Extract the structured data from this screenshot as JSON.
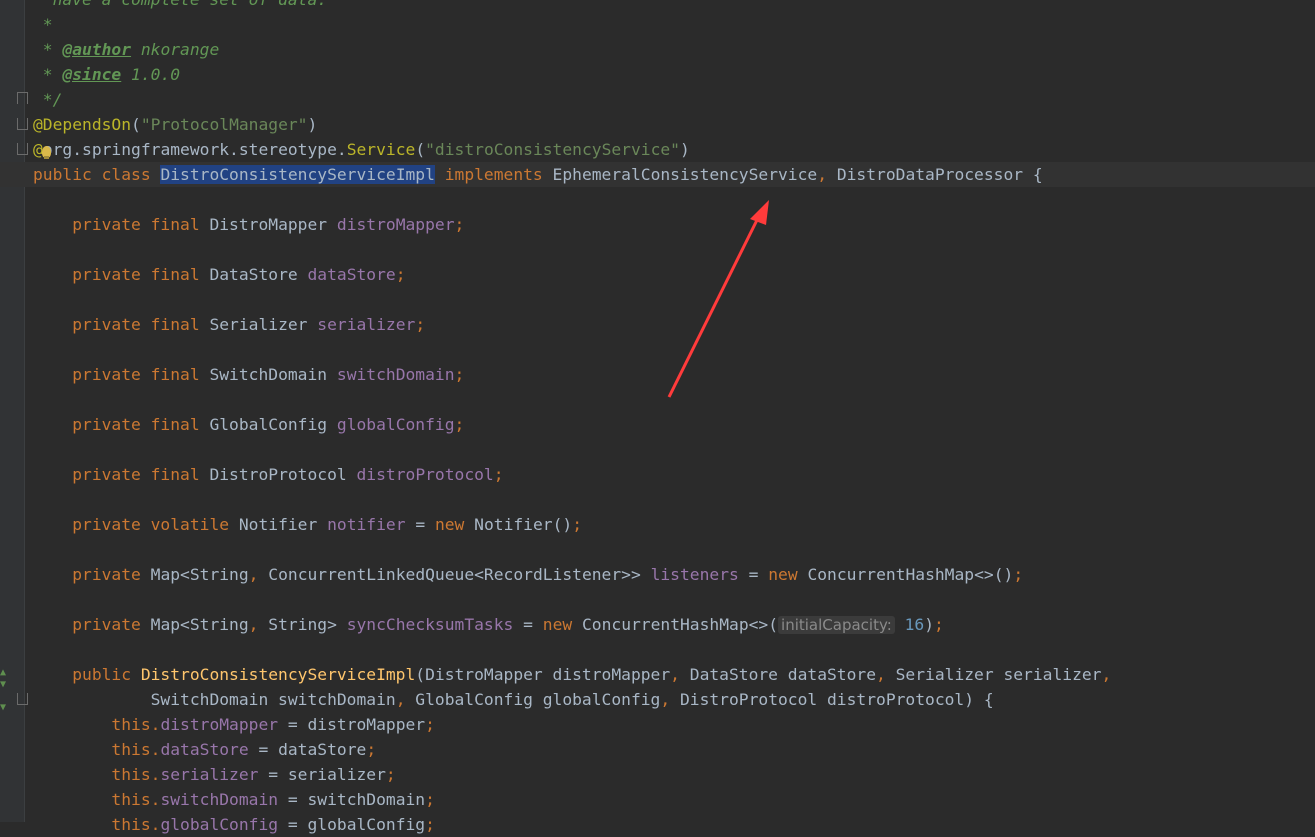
{
  "editor": {
    "lines": [
      {
        "parts": [
          [
            "d",
            "  have a complete set of data."
          ]
        ]
      },
      {
        "parts": [
          [
            "d",
            " *"
          ]
        ]
      },
      {
        "parts": [
          [
            "d",
            " * "
          ],
          [
            "dt",
            "@author"
          ],
          [
            "d",
            " nkorange"
          ]
        ]
      },
      {
        "parts": [
          [
            "d",
            " * "
          ],
          [
            "dt",
            "@since"
          ],
          [
            "d",
            " 1.0.0"
          ]
        ]
      },
      {
        "parts": [
          [
            "d",
            " */"
          ]
        ]
      },
      {
        "parts": [
          [
            "an",
            "@DependsOn"
          ],
          [
            "",
            "("
          ],
          [
            "s",
            "\"ProtocolManager\""
          ],
          [
            "",
            ")"
          ]
        ]
      },
      {
        "parts": [
          [
            "an",
            "@"
          ],
          [
            "",
            "org.springframework.stereotype."
          ],
          [
            "an",
            "Service"
          ],
          [
            "",
            "("
          ],
          [
            "s",
            "\"distroConsistencyService\""
          ],
          [
            "",
            ")"
          ]
        ]
      },
      {
        "current": true,
        "parts": [
          [
            "k",
            "public class "
          ],
          [
            "sel",
            "DistroConsistencyServiceImpl"
          ],
          [
            "k",
            " implements "
          ],
          [
            "",
            "EphemeralConsistencyService"
          ],
          [
            "k",
            ", "
          ],
          [
            "",
            "DistroDataProcessor {"
          ]
        ]
      },
      {
        "parts": []
      },
      {
        "parts": [
          [
            "k",
            "    private final "
          ],
          [
            "",
            "DistroMapper "
          ],
          [
            "f",
            "distroMapper"
          ],
          [
            "k",
            ";"
          ]
        ]
      },
      {
        "parts": []
      },
      {
        "parts": [
          [
            "k",
            "    private final "
          ],
          [
            "",
            "DataStore "
          ],
          [
            "f",
            "dataStore"
          ],
          [
            "k",
            ";"
          ]
        ]
      },
      {
        "parts": []
      },
      {
        "parts": [
          [
            "k",
            "    private final "
          ],
          [
            "",
            "Serializer "
          ],
          [
            "f",
            "serializer"
          ],
          [
            "k",
            ";"
          ]
        ]
      },
      {
        "parts": []
      },
      {
        "parts": [
          [
            "k",
            "    private final "
          ],
          [
            "",
            "SwitchDomain "
          ],
          [
            "f",
            "switchDomain"
          ],
          [
            "k",
            ";"
          ]
        ]
      },
      {
        "parts": []
      },
      {
        "parts": [
          [
            "k",
            "    private final "
          ],
          [
            "",
            "GlobalConfig "
          ],
          [
            "f",
            "globalConfig"
          ],
          [
            "k",
            ";"
          ]
        ]
      },
      {
        "parts": []
      },
      {
        "parts": [
          [
            "k",
            "    private final "
          ],
          [
            "",
            "DistroProtocol "
          ],
          [
            "f",
            "distroProtocol"
          ],
          [
            "k",
            ";"
          ]
        ]
      },
      {
        "parts": []
      },
      {
        "parts": [
          [
            "k",
            "    private volatile "
          ],
          [
            "",
            "Notifier "
          ],
          [
            "f",
            "notifier"
          ],
          [
            "",
            " = "
          ],
          [
            "k",
            "new "
          ],
          [
            "",
            "Notifier()"
          ],
          [
            "k",
            ";"
          ]
        ]
      },
      {
        "parts": []
      },
      {
        "parts": [
          [
            "k",
            "    private "
          ],
          [
            "",
            "Map<String"
          ],
          [
            "k",
            ", "
          ],
          [
            "",
            "ConcurrentLinkedQueue<RecordListener>> "
          ],
          [
            "f",
            "listeners"
          ],
          [
            "",
            " = "
          ],
          [
            "k",
            "new "
          ],
          [
            "",
            "ConcurrentHashMap<>()"
          ],
          [
            "k",
            ";"
          ]
        ]
      },
      {
        "parts": []
      },
      {
        "parts": [
          [
            "k",
            "    private "
          ],
          [
            "",
            "Map<String"
          ],
          [
            "k",
            ", "
          ],
          [
            "",
            "String> "
          ],
          [
            "f",
            "syncChecksumTasks"
          ],
          [
            "",
            " = "
          ],
          [
            "k",
            "new "
          ],
          [
            "",
            "ConcurrentHashMap<>("
          ],
          [
            "hint",
            "initialCapacity:"
          ],
          [
            "n",
            " 16"
          ],
          [
            "",
            ")"
          ],
          [
            "k",
            ";"
          ]
        ]
      },
      {
        "parts": []
      },
      {
        "parts": [
          [
            "k",
            "    public "
          ],
          [
            "m",
            "DistroConsistencyServiceImpl"
          ],
          [
            "",
            "(DistroMapper distroMapper"
          ],
          [
            "k",
            ", "
          ],
          [
            "",
            "DataStore dataStore"
          ],
          [
            "k",
            ", "
          ],
          [
            "",
            "Serializer serializer"
          ],
          [
            "k",
            ","
          ]
        ]
      },
      {
        "parts": [
          [
            "",
            "            SwitchDomain switchDomain"
          ],
          [
            "k",
            ", "
          ],
          [
            "",
            "GlobalConfig globalConfig"
          ],
          [
            "k",
            ", "
          ],
          [
            "",
            "DistroProtocol distroProtocol) {"
          ]
        ]
      },
      {
        "parts": [
          [
            "k",
            "        this."
          ],
          [
            "f",
            "distroMapper"
          ],
          [
            "",
            " = distroMapper"
          ],
          [
            "k",
            ";"
          ]
        ]
      },
      {
        "parts": [
          [
            "k",
            "        this."
          ],
          [
            "f",
            "dataStore"
          ],
          [
            "",
            " = dataStore"
          ],
          [
            "k",
            ";"
          ]
        ]
      },
      {
        "parts": [
          [
            "k",
            "        this."
          ],
          [
            "f",
            "serializer"
          ],
          [
            "",
            " = serializer"
          ],
          [
            "k",
            ";"
          ]
        ]
      },
      {
        "parts": [
          [
            "k",
            "        this."
          ],
          [
            "f",
            "switchDomain"
          ],
          [
            "",
            " = switchDomain"
          ],
          [
            "k",
            ";"
          ]
        ]
      },
      {
        "parts": [
          [
            "k",
            "        this."
          ],
          [
            "f",
            "globalConfig"
          ],
          [
            "",
            " = globalConfig"
          ],
          [
            "k",
            ";"
          ]
        ]
      }
    ]
  },
  "annotation": {
    "color": "#ff3b3b",
    "icon": "red-arrow-icon"
  }
}
